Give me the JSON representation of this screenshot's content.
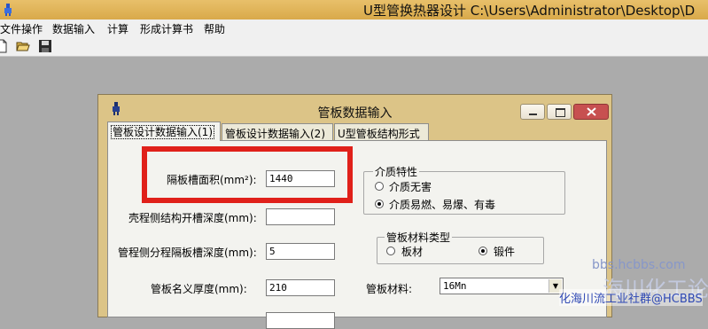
{
  "app": {
    "title": "U型管换热器设计 C:\\Users\\Administrator\\Desktop\\D",
    "title_bar_color": "#d9a94a",
    "icon": "app-icon"
  },
  "menu": [
    "文件操作",
    "数据输入",
    "计算",
    "形成计算书",
    "帮助"
  ],
  "toolbar": {
    "icons": [
      "new-file-icon",
      "open-folder-icon",
      "save-icon"
    ]
  },
  "dialog": {
    "title": "管板数据输入",
    "title_bar_color": "#dcc487",
    "icon": "dialog-icon",
    "controls": [
      "minimize-icon",
      "maximize-icon",
      "close-icon"
    ],
    "tabs": [
      {
        "label": "管板设计数据输入(1)",
        "active": true
      },
      {
        "label": "管板设计数据输入(2)",
        "active": false
      },
      {
        "label": "U型管板结构形式",
        "active": false
      }
    ],
    "fields": [
      {
        "label": "隔板槽面积(mm²):",
        "value": "1440"
      },
      {
        "label": "壳程侧结构开槽深度(mm):",
        "value": ""
      },
      {
        "label": "管程侧分程隔板槽深度(mm):",
        "value": "5"
      },
      {
        "label": "管板名义厚度(mm):",
        "value": "210"
      }
    ],
    "medium_group": {
      "title": "介质特性",
      "options": [
        {
          "label": "介质无害",
          "selected": false
        },
        {
          "label": "介质易燃、易爆、有毒",
          "selected": true
        }
      ]
    },
    "material_type_group": {
      "title": "管板材料类型",
      "options": [
        {
          "label": "板材",
          "selected": false
        },
        {
          "label": "锻件",
          "selected": true
        }
      ]
    },
    "material": {
      "label": "管板材料:",
      "value": "16Mn"
    }
  },
  "annotation": {
    "highlight_color": "#e0201a"
  },
  "watermark": {
    "line1": "bbs.hcbbs.com",
    "line2": "海川化工论坛",
    "line3": "化海川流工业社群@HCBBS"
  }
}
